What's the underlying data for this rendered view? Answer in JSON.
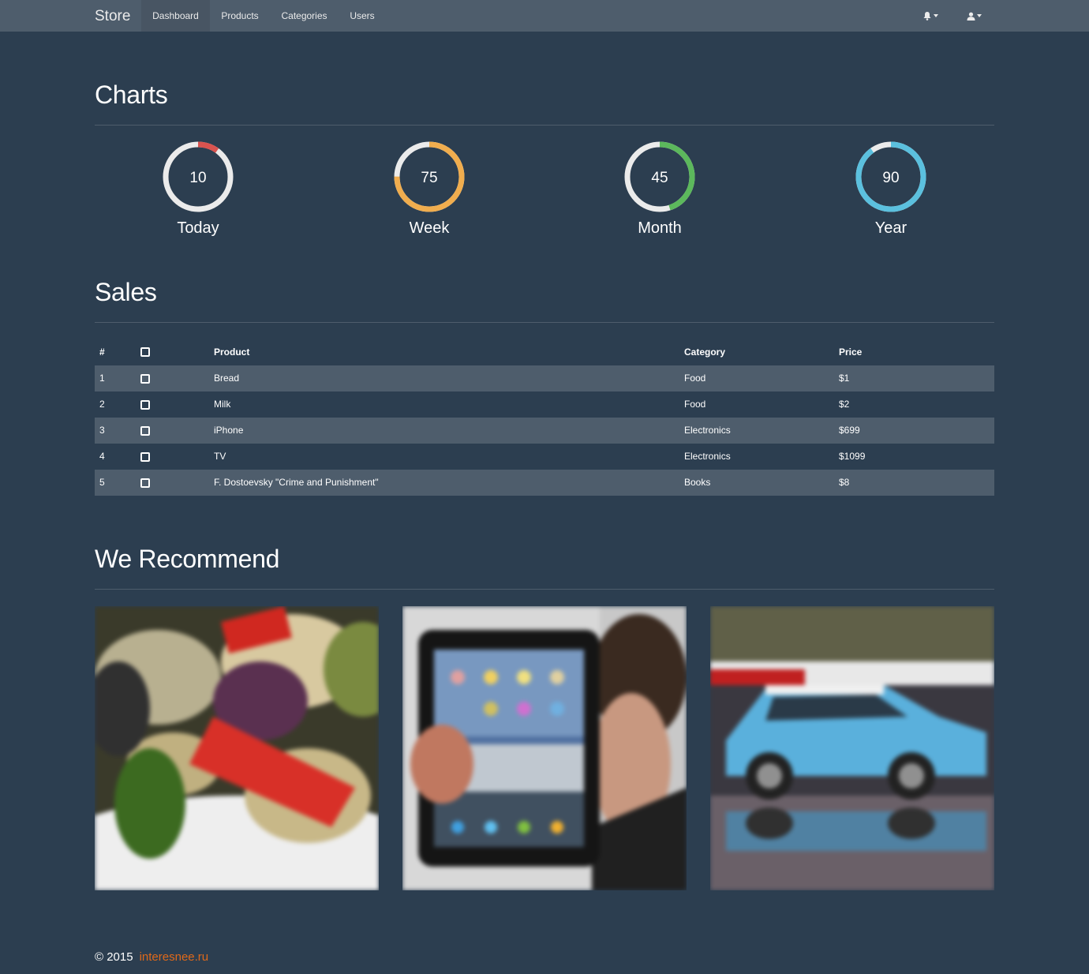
{
  "navbar": {
    "brand": "Store",
    "items": [
      {
        "label": "Dashboard",
        "active": true
      },
      {
        "label": "Products",
        "active": false
      },
      {
        "label": "Categories",
        "active": false
      },
      {
        "label": "Users",
        "active": false
      }
    ],
    "icons": [
      "bell-icon",
      "user-icon"
    ]
  },
  "charts": {
    "title": "Charts",
    "donuts": [
      {
        "value": "10",
        "label": "Today",
        "percent": 10,
        "color": "#d9534f"
      },
      {
        "value": "75",
        "label": "Week",
        "percent": 75,
        "color": "#f0ad4e"
      },
      {
        "value": "45",
        "label": "Month",
        "percent": 45,
        "color": "#5cb85c"
      },
      {
        "value": "90",
        "label": "Year",
        "percent": 90,
        "color": "#5bc0de"
      }
    ]
  },
  "sales": {
    "title": "Sales",
    "columns": {
      "num": "#",
      "product": "Product",
      "category": "Category",
      "price": "Price"
    },
    "rows": [
      {
        "num": "1",
        "product": "Bread",
        "category": "Food",
        "price": "$1"
      },
      {
        "num": "2",
        "product": "Milk",
        "category": "Food",
        "price": "$2"
      },
      {
        "num": "3",
        "product": "iPhone",
        "category": "Electronics",
        "price": "$699"
      },
      {
        "num": "4",
        "product": "TV",
        "category": "Electronics",
        "price": "$1099"
      },
      {
        "num": "5",
        "product": "F. Dostoevsky \"Crime and Punishment\"",
        "category": "Books",
        "price": "$8"
      }
    ]
  },
  "recommend": {
    "title": "We Recommend",
    "images": [
      "grilled-vegetables-photo",
      "tablet-photo",
      "blue-car-photo"
    ]
  },
  "footer": {
    "copyright": "© 2015",
    "link": "interesnee.ru"
  },
  "colors": {
    "background": "#2c3e50",
    "navbar": "#4e5d6c",
    "accent": "#df691a",
    "donut_track": "#ebebeb"
  }
}
